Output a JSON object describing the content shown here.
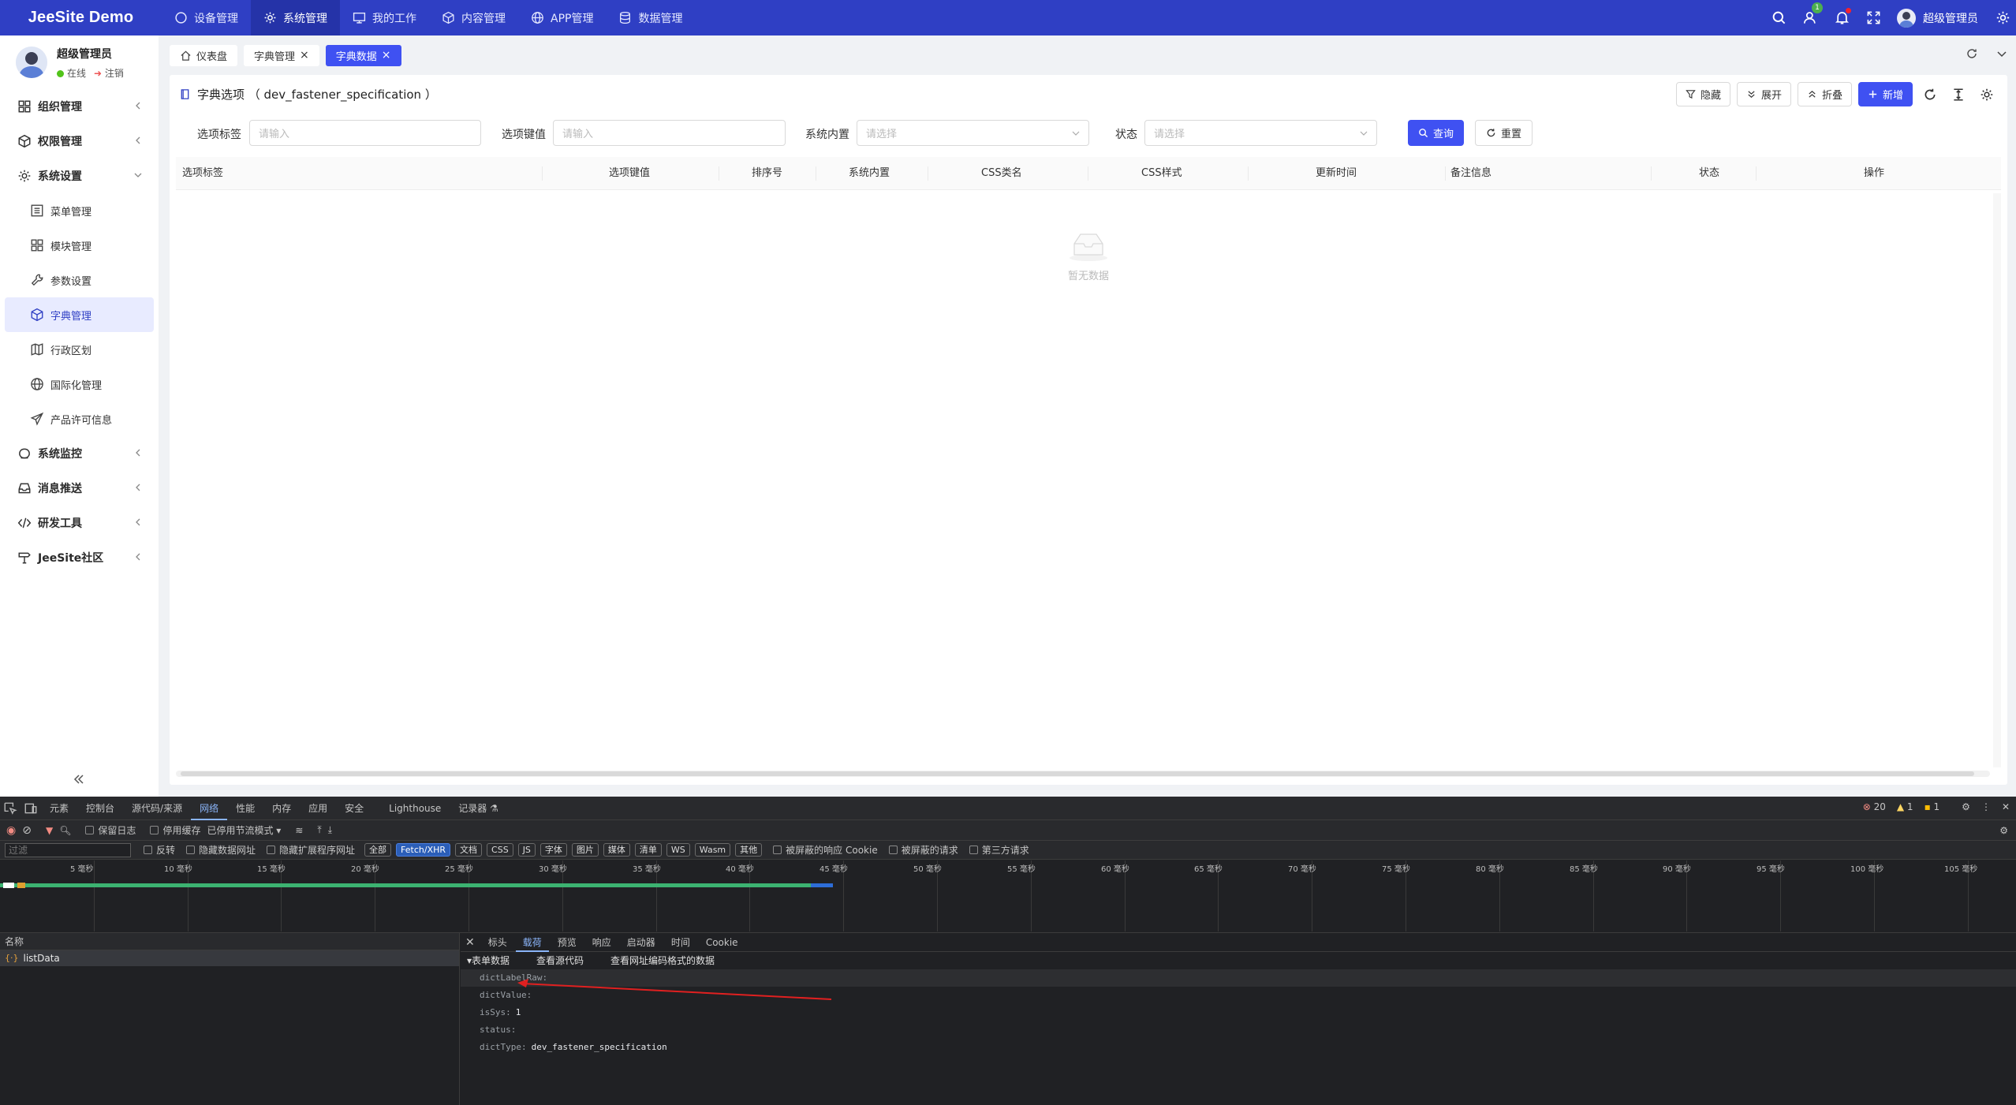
{
  "app": {
    "brand": "JeeSite Demo",
    "top_menu": [
      {
        "label": "设备管理",
        "icon": "circle-icon",
        "active": false
      },
      {
        "label": "系统管理",
        "icon": "gear-icon",
        "active": true
      },
      {
        "label": "我的工作",
        "icon": "monitor-icon",
        "active": false
      },
      {
        "label": "内容管理",
        "icon": "cube-icon",
        "active": false
      },
      {
        "label": "APP管理",
        "icon": "globe-icon",
        "active": false
      },
      {
        "label": "数据管理",
        "icon": "database-icon",
        "active": false
      }
    ],
    "top_right": {
      "notify_badge": "1",
      "user_name": "超级管理员"
    }
  },
  "sidebar": {
    "user": {
      "name": "超级管理员",
      "online": "在线",
      "logout": "注销"
    },
    "items": [
      {
        "label": "组织管理",
        "icon": "grid-icon"
      },
      {
        "label": "权限管理",
        "icon": "cube-icon"
      },
      {
        "label": "系统设置",
        "icon": "gear-icon",
        "expanded": true
      },
      {
        "label": "系统监控",
        "icon": "monitor-icon"
      },
      {
        "label": "消息推送",
        "icon": "inbox-icon"
      },
      {
        "label": "研发工具",
        "icon": "code-icon"
      },
      {
        "label": "JeeSite社区",
        "icon": "signpost-icon"
      }
    ],
    "sub_items": [
      {
        "label": "菜单管理",
        "icon": "list-icon"
      },
      {
        "label": "模块管理",
        "icon": "grid-icon"
      },
      {
        "label": "参数设置",
        "icon": "wrench-icon"
      },
      {
        "label": "字典管理",
        "icon": "cube-icon",
        "active": true
      },
      {
        "label": "行政区划",
        "icon": "map-icon"
      },
      {
        "label": "国际化管理",
        "icon": "globe-icon"
      },
      {
        "label": "产品许可信息",
        "icon": "send-icon"
      }
    ]
  },
  "tabs": [
    {
      "label": "仪表盘",
      "closable": false
    },
    {
      "label": "字典管理",
      "closable": true
    },
    {
      "label": "字典数据",
      "closable": true,
      "active": true
    }
  ],
  "card": {
    "title": "字典选项 （ dev_fastener_specification ）",
    "toolbar": {
      "hide": "隐藏",
      "expand": "展开",
      "collapse": "折叠",
      "add": "新增"
    },
    "search": {
      "label_field": "选项标签",
      "value_field": "选项键值",
      "sys_field": "系统内置",
      "status_field": "状态",
      "input_placeholder": "请输入",
      "select_placeholder": "请选择",
      "query": "查询",
      "reset": "重置"
    },
    "columns": [
      "选项标签",
      "选项键值",
      "排序号",
      "系统内置",
      "CSS类名",
      "CSS样式",
      "更新时间",
      "备注信息",
      "状态",
      "操作"
    ],
    "empty_text": "暂无数据"
  },
  "devtools": {
    "tabs": [
      "元素",
      "控制台",
      "源代码/来源",
      "网络",
      "性能",
      "内存",
      "应用",
      "安全",
      "Lighthouse",
      "记录器"
    ],
    "active_tab": "网络",
    "errors": "20",
    "warnings": "1",
    "info": "1",
    "toolbar1": {
      "preserve_log": "保留日志",
      "disable_cache": "停用缓存",
      "throttle": "已停用节流模式"
    },
    "filter_placeholder": "过滤",
    "toolbar2": {
      "invert": "反转",
      "hide_data_urls": "隐藏数据网址",
      "hide_ext_urls": "隐藏扩展程序网址",
      "pills": [
        "全部",
        "Fetch/XHR",
        "文档",
        "CSS",
        "JS",
        "字体",
        "图片",
        "媒体",
        "清单",
        "WS",
        "Wasm",
        "其他"
      ],
      "active_pill": "Fetch/XHR",
      "blocked_cookies": "被屏蔽的响应 Cookie",
      "blocked_requests": "被屏蔽的请求",
      "third_party": "第三方请求"
    },
    "timeline_ticks": [
      "5 毫秒",
      "10 毫秒",
      "15 毫秒",
      "20 毫秒",
      "25 毫秒",
      "30 毫秒",
      "35 毫秒",
      "40 毫秒",
      "45 毫秒",
      "50 毫秒",
      "55 毫秒",
      "60 毫秒",
      "65 毫秒",
      "70 毫秒",
      "75 毫秒",
      "80 毫秒",
      "85 毫秒",
      "90 毫秒",
      "95 毫秒",
      "100 毫秒",
      "105 毫秒"
    ],
    "names_header": "名称",
    "request_name": "listData",
    "detail_tabs": [
      "标头",
      "载荷",
      "预览",
      "响应",
      "启动器",
      "时间",
      "Cookie"
    ],
    "active_detail_tab": "载荷",
    "payload": {
      "section": "▾表单数据",
      "view_source": "查看源代码",
      "view_url_encoded": "查看网址编码格式的数据",
      "fields": [
        {
          "key": "dictLabelRaw:",
          "value": ""
        },
        {
          "key": "dictValue:",
          "value": ""
        },
        {
          "key": "isSys:",
          "value": "1"
        },
        {
          "key": "status:",
          "value": ""
        },
        {
          "key": "dictType:",
          "value": "dev_fastener_specification"
        }
      ]
    }
  }
}
